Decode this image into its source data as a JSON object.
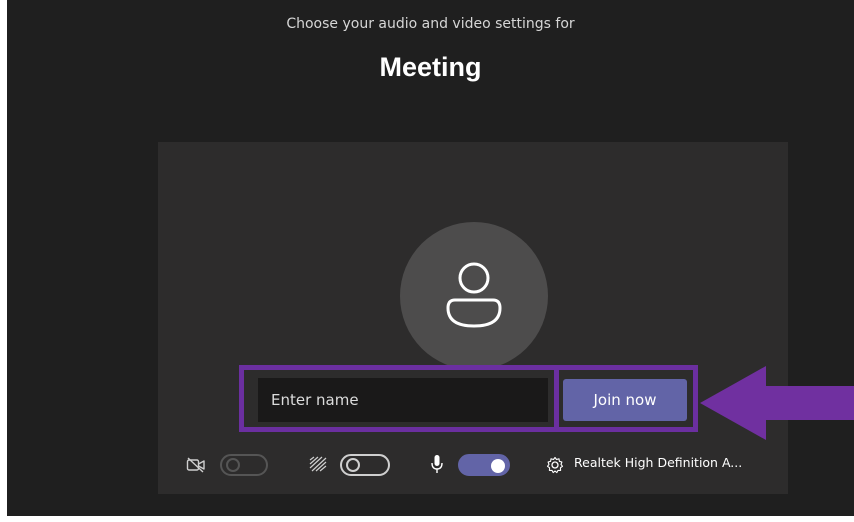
{
  "header": {
    "subtitle": "Choose your audio and video settings for",
    "meeting_title": "Meeting"
  },
  "join_form": {
    "name_placeholder": "Enter name",
    "name_value": "",
    "join_label": "Join now"
  },
  "controls": {
    "camera": {
      "icon": "camera-off-icon",
      "enabled": false
    },
    "background_blur": {
      "icon": "background-effects-icon",
      "enabled": false
    },
    "microphone": {
      "icon": "microphone-icon",
      "enabled": true
    },
    "device_settings": {
      "icon": "gear-icon",
      "device_name": "Realtek High Definition A..."
    }
  },
  "annotation": {
    "highlight_color": "#6b2fa0",
    "arrow_color": "#7030a0"
  },
  "colors": {
    "accent": "#6264a7",
    "background": "#1f1f1f",
    "card": "#2d2c2c"
  }
}
